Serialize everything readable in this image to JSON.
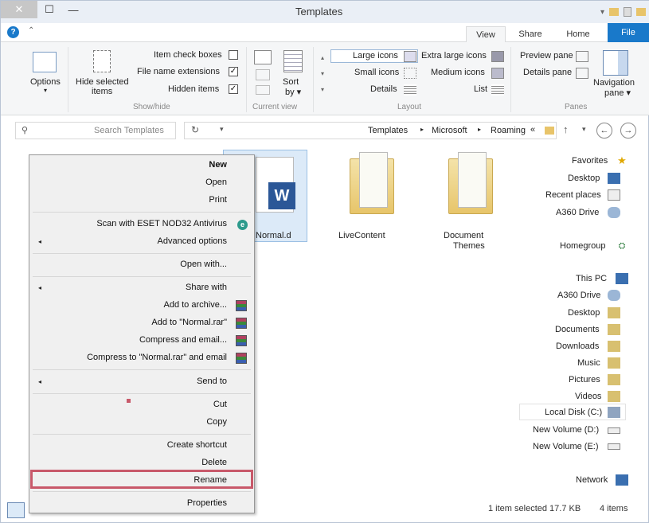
{
  "window": {
    "title": "Templates"
  },
  "titlebar": {
    "minimize": "—",
    "maximize": "☐",
    "close": "✕"
  },
  "tabs": {
    "file": "File",
    "home": "Home",
    "share": "Share",
    "view": "View"
  },
  "ribbon": {
    "panes": {
      "navigation_pane": "Navigation",
      "navigation_pane2": "pane ▾",
      "preview_pane": "Preview pane",
      "details_pane": "Details pane",
      "group_label": "Panes"
    },
    "layout": {
      "extra_large": "Extra large icons",
      "large": "Large icons",
      "medium": "Medium icons",
      "small": "Small icons",
      "list": "List",
      "details": "Details",
      "group_label": "Layout"
    },
    "current_view": {
      "sort_by": "Sort",
      "sort_by2": "by ▾",
      "group_label": "Current view"
    },
    "show_hide": {
      "item_check_boxes": "Item check boxes",
      "file_name_extensions": "File name extensions",
      "hidden_items": "Hidden items",
      "hide_selected": "Hide selected",
      "hide_selected2": "items",
      "group_label": "Show/hide"
    },
    "options": {
      "label": "Options",
      "arrow": "▾"
    }
  },
  "address": {
    "breadcrumb": [
      "Roaming",
      "Microsoft",
      "Templates"
    ],
    "overflow": "«",
    "search_placeholder": "Search Templates"
  },
  "nav_pane": {
    "favorites": {
      "label": "Favorites",
      "items": [
        "Desktop",
        "Recent places",
        "A360 Drive"
      ]
    },
    "homegroup": "Homegroup",
    "this_pc": {
      "label": "This PC",
      "items": [
        "A360 Drive",
        "Desktop",
        "Documents",
        "Downloads",
        "Music",
        "Pictures",
        "Videos",
        "Local Disk (C:)",
        "New Volume (D:)",
        "New Volume (E:)"
      ]
    },
    "network": "Network"
  },
  "files": [
    {
      "name": "Document Themes",
      "name2": "Themes",
      "name1": "Document"
    },
    {
      "name": "LiveContent"
    },
    {
      "name": "Normal.dotm",
      "shown": "Normal.d"
    }
  ],
  "context_menu": {
    "new": "New",
    "open": "Open",
    "print": "Print",
    "scan": "Scan with ESET NOD32 Antivirus",
    "advanced": "Advanced options",
    "open_with": "Open with...",
    "share_with": "Share with",
    "add_archive": "Add to archive...",
    "add_rar": "Add to \"Normal.rar\"",
    "compress_email": "Compress and email...",
    "compress_rar_email": "Compress to \"Normal.rar\" and email",
    "send_to": "Send to",
    "cut": "Cut",
    "copy": "Copy",
    "create_shortcut": "Create shortcut",
    "delete": "Delete",
    "rename": "Rename",
    "properties": "Properties"
  },
  "status": {
    "items": "4 items",
    "selected": "1 item selected  17.7 KB"
  },
  "colors": {
    "accent": "#1979ca",
    "rename_highlight": "#c8596a"
  }
}
